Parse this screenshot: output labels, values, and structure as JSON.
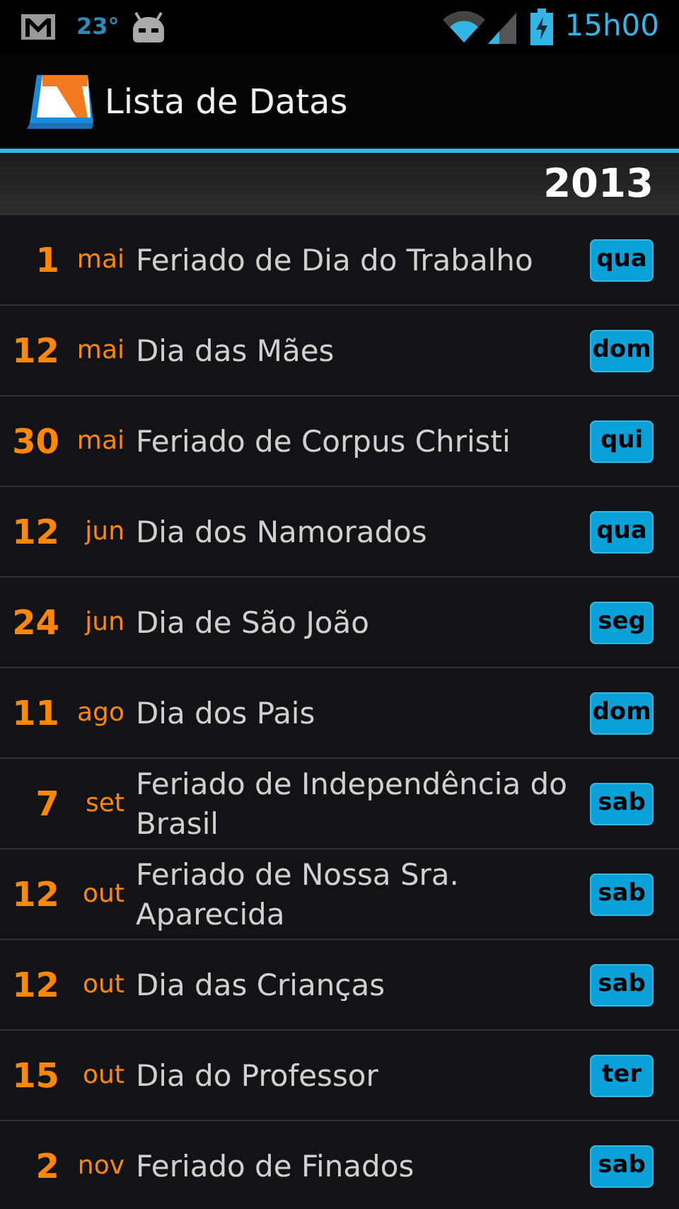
{
  "status_bar": {
    "temperature": "23°",
    "time": "15h00"
  },
  "action_bar": {
    "title": "Lista de Datas"
  },
  "year": "2013",
  "dates": [
    {
      "day": "1",
      "month": "mai",
      "name": "Feriado de Dia do Trabalho",
      "weekday": "qua"
    },
    {
      "day": "12",
      "month": "mai",
      "name": "Dia das Mães",
      "weekday": "dom"
    },
    {
      "day": "30",
      "month": "mai",
      "name": "Feriado de Corpus Christi",
      "weekday": "qui"
    },
    {
      "day": "12",
      "month": "jun",
      "name": "Dia dos Namorados",
      "weekday": "qua"
    },
    {
      "day": "24",
      "month": "jun",
      "name": "Dia de São João",
      "weekday": "seg"
    },
    {
      "day": "11",
      "month": "ago",
      "name": "Dia dos Pais",
      "weekday": "dom"
    },
    {
      "day": "7",
      "month": "set",
      "name": "Feriado de Independência do Brasil",
      "weekday": "sab"
    },
    {
      "day": "12",
      "month": "out",
      "name": "Feriado de Nossa Sra. Aparecida",
      "weekday": "sab"
    },
    {
      "day": "12",
      "month": "out",
      "name": "Dia das Crianças",
      "weekday": "sab"
    },
    {
      "day": "15",
      "month": "out",
      "name": "Dia do Professor",
      "weekday": "ter"
    },
    {
      "day": "2",
      "month": "nov",
      "name": "Feriado de Finados",
      "weekday": "sab"
    }
  ]
}
